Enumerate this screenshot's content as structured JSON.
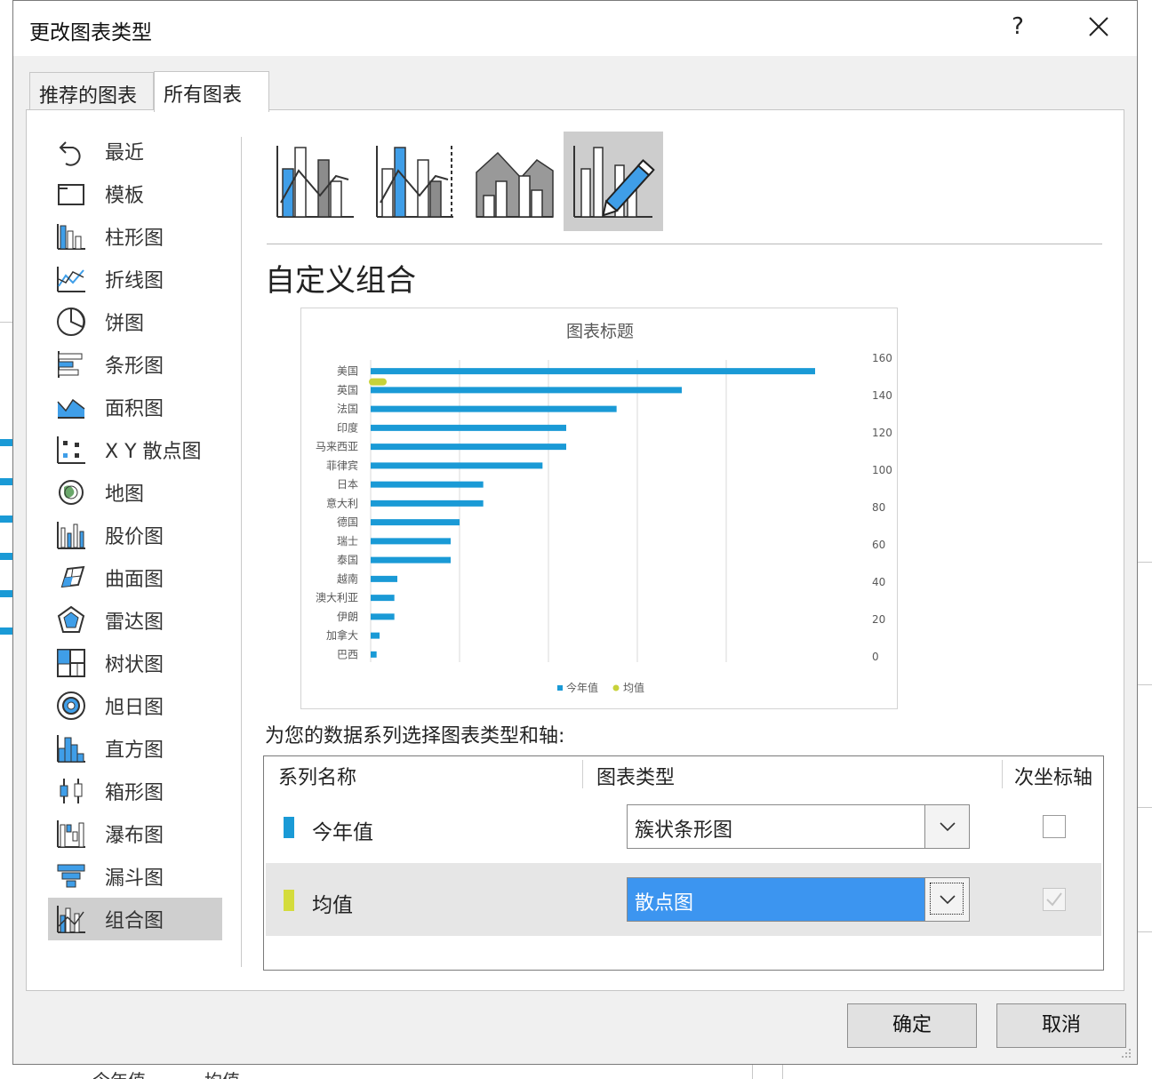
{
  "dialog": {
    "title": "更改图表类型",
    "help_label": "?",
    "tabs": [
      {
        "label": "推荐的图表",
        "active": false
      },
      {
        "label": "所有图表",
        "active": true
      }
    ]
  },
  "nav": {
    "items": [
      {
        "label": "最近",
        "icon": "recent-icon"
      },
      {
        "label": "模板",
        "icon": "template-folder-icon"
      },
      {
        "label": "柱形图",
        "icon": "column-chart-icon"
      },
      {
        "label": "折线图",
        "icon": "line-chart-icon"
      },
      {
        "label": "饼图",
        "icon": "pie-chart-icon"
      },
      {
        "label": "条形图",
        "icon": "bar-chart-icon"
      },
      {
        "label": "面积图",
        "icon": "area-chart-icon"
      },
      {
        "label": "X Y 散点图",
        "icon": "scatter-chart-icon"
      },
      {
        "label": "地图",
        "icon": "map-chart-icon"
      },
      {
        "label": "股价图",
        "icon": "stock-chart-icon"
      },
      {
        "label": "曲面图",
        "icon": "surface-chart-icon"
      },
      {
        "label": "雷达图",
        "icon": "radar-chart-icon"
      },
      {
        "label": "树状图",
        "icon": "treemap-chart-icon"
      },
      {
        "label": "旭日图",
        "icon": "sunburst-chart-icon"
      },
      {
        "label": "直方图",
        "icon": "histogram-chart-icon"
      },
      {
        "label": "箱形图",
        "icon": "box-whisker-chart-icon"
      },
      {
        "label": "瀑布图",
        "icon": "waterfall-chart-icon"
      },
      {
        "label": "漏斗图",
        "icon": "funnel-chart-icon"
      },
      {
        "label": "组合图",
        "icon": "combo-chart-icon",
        "selected": true
      }
    ],
    "selected_index": 18
  },
  "subtypes": [
    {
      "icon": "clustered-column-line-icon",
      "selected": false
    },
    {
      "icon": "clustered-column-line-secondary-axis-icon",
      "selected": false
    },
    {
      "icon": "stacked-area-clustered-column-icon",
      "selected": false
    },
    {
      "icon": "custom-combination-icon",
      "selected": true
    }
  ],
  "section_title": "自定义组合",
  "chart_data": {
    "type": "bar",
    "title": "图表标题",
    "categories": [
      "美国",
      "英国",
      "法国",
      "印度",
      "马来西亚",
      "菲律宾",
      "日本",
      "意大利",
      "德国",
      "瑞士",
      "泰国",
      "越南",
      "澳大利亚",
      "伊朗",
      "加拿大",
      "巴西"
    ],
    "series": [
      {
        "name": "今年值",
        "values": [
          150,
          105,
          83,
          66,
          66,
          58,
          38,
          38,
          30,
          27,
          27,
          9,
          8,
          8,
          3,
          2
        ],
        "color": "#1a9ad6"
      },
      {
        "name": "均值",
        "type": "scatter",
        "values": [
          3
        ],
        "color": "#c8d23a"
      }
    ],
    "secondary_axis": {
      "ticks": [
        160,
        140,
        120,
        100,
        80,
        60,
        40,
        20,
        0
      ]
    },
    "xlim": [
      0,
      150
    ],
    "grid": true,
    "legend": "bottom"
  },
  "series_config": {
    "label": "为您的数据系列选择图表类型和轴:",
    "headers": {
      "name": "系列名称",
      "type": "图表类型",
      "secondary": "次坐标轴"
    },
    "rows": [
      {
        "name": "今年值",
        "color": "#1a9ad6",
        "chart_type": "簇状条形图",
        "secondary_axis": false,
        "selected": false
      },
      {
        "name": "均值",
        "color": "#d4dc3c",
        "chart_type": "散点图",
        "secondary_axis": true,
        "selected": true
      }
    ]
  },
  "buttons": {
    "ok": "确定",
    "cancel": "取消"
  },
  "colors": {
    "accent": "#3c95f0",
    "series_blue": "#1a9ad6",
    "series_yellow": "#d4dc3c",
    "selection_gray": "#cfcfcf"
  }
}
